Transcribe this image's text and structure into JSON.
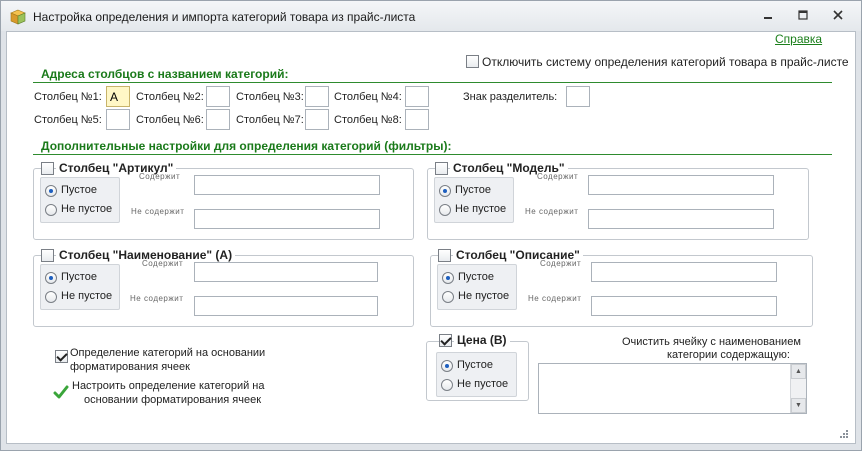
{
  "window": {
    "title": "Настройка определения и импорта категорий товара из прайс-листа",
    "help_link": "Справка"
  },
  "disable_system": {
    "label": "Отключить систему определения категорий товара в прайс-листе",
    "checked": false
  },
  "addresses": {
    "title": "Адреса столбцов с названием категорий:",
    "columns": [
      {
        "label": "Столбец №1:",
        "value": "A"
      },
      {
        "label": "Столбец №2:",
        "value": ""
      },
      {
        "label": "Столбец №3:",
        "value": ""
      },
      {
        "label": "Столбец №4:",
        "value": ""
      },
      {
        "label": "Столбец №5:",
        "value": ""
      },
      {
        "label": "Столбец №6:",
        "value": ""
      },
      {
        "label": "Столбец №7:",
        "value": ""
      },
      {
        "label": "Столбец №8:",
        "value": ""
      }
    ],
    "separator_label": "Знак разделитель:",
    "separator_value": ""
  },
  "filters": {
    "title": "Дополнительные настройки для определения категорий (фильтры):",
    "radio_empty": "Пустое",
    "radio_not_empty": "Не пустое",
    "contains_label": "Содержит",
    "not_contains_label": "Не содержит",
    "groups": [
      {
        "title": "Столбец \"Артикул\"",
        "checked": false,
        "selected": "empty",
        "contains": "",
        "not_contains": ""
      },
      {
        "title": "Столбец \"Модель\"",
        "checked": false,
        "selected": "empty",
        "contains": "",
        "not_contains": ""
      },
      {
        "title": "Столбец \"Наименование\" (A)",
        "checked": false,
        "selected": "empty",
        "contains": "",
        "not_contains": ""
      },
      {
        "title": "Столбец \"Описание\"",
        "checked": false,
        "selected": "empty",
        "contains": "",
        "not_contains": ""
      }
    ],
    "price": {
      "title": "Цена (B)",
      "checked": true,
      "selected": "empty"
    }
  },
  "format_detection": {
    "label_line1": "Определение категорий на основании",
    "label_line2": "форматирования ячеек",
    "checked": true
  },
  "configure_format": {
    "label_line1": "Настроить определение категорий на",
    "label_line2": "основании форматирования ячеек"
  },
  "clear_cell": {
    "label_line1": "Очистить ячейку с наименованием",
    "label_line2": "категории содержащую:",
    "value": ""
  },
  "colors": {
    "accent": "#1a7a1a",
    "radio_dot": "#1e5fbf",
    "active_field": "#fff7c6"
  }
}
